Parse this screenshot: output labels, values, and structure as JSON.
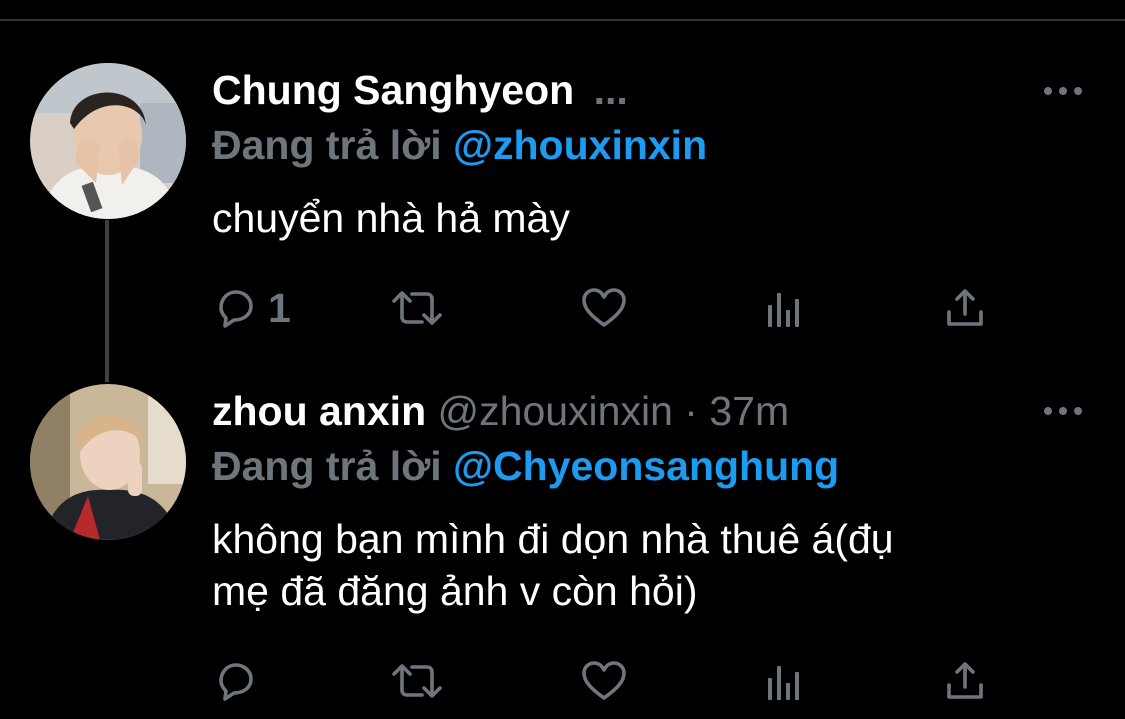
{
  "theme": {
    "background": "#000000",
    "muted": "#6e767d",
    "accent": "#1d9bf0",
    "text": "#ffffff"
  },
  "tweets": [
    {
      "display_name": "Chung Sanghyeon",
      "handle": "",
      "separator": "",
      "time": "",
      "truncation": "...",
      "reply_prefix": "Đang trả lời",
      "reply_to": "@zhouxinxin",
      "text_lines": [
        "chuyển nhà hả mày"
      ],
      "reply_count": "1",
      "icons": [
        "reply-icon",
        "retweet-icon",
        "like-icon",
        "stats-icon",
        "share-icon",
        "more-icon"
      ]
    },
    {
      "display_name": "zhou anxin",
      "handle": "@zhouxinxin",
      "separator": "·",
      "time": "37m",
      "truncation": "",
      "reply_prefix": "Đang trả lời",
      "reply_to": "@Chyeonsanghung",
      "text_lines": [
        "không bạn mình đi dọn nhà thuê á(đụ",
        "mẹ đã đăng ảnh v còn hỏi)"
      ],
      "reply_count": "",
      "icons": [
        "reply-icon",
        "retweet-icon",
        "like-icon",
        "stats-icon",
        "share-icon",
        "more-icon"
      ]
    }
  ]
}
